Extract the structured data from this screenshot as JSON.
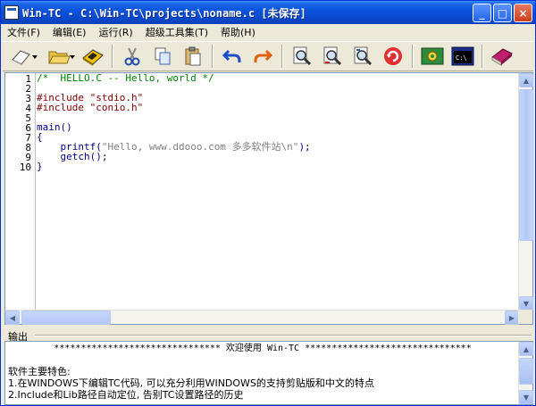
{
  "window": {
    "title": "Win-TC - C:\\Win-TC\\projects\\noname.c [未保存]",
    "controls": {
      "minimize": "_",
      "maximize": "□",
      "close": "×"
    }
  },
  "menu": {
    "items": [
      "文件(F)",
      "编辑(E)",
      "运行(R)",
      "超级工具集(T)",
      "帮助(H)"
    ]
  },
  "toolbar": {
    "icons": [
      "new-file-icon",
      "open-folder-icon",
      "save-disk-icon",
      "cut-icon",
      "copy-icon",
      "paste-icon",
      "undo-icon",
      "redo-icon",
      "find-icon",
      "find-next-icon",
      "replace-icon",
      "refresh-icon",
      "compile-icon",
      "run-console-icon",
      "help-book-icon"
    ]
  },
  "editor": {
    "line_numbers": [
      "1",
      "2",
      "3",
      "4",
      "5",
      "6",
      "7",
      "8",
      "9",
      "10"
    ],
    "lines": [
      {
        "text": "/*  HELLO.C -- Hello, world */",
        "kind": "comment"
      },
      {
        "text": "",
        "kind": "plain"
      },
      {
        "text": "#include \"stdio.h\"",
        "kind": "pre"
      },
      {
        "text": "#include \"conio.h\"",
        "kind": "pre"
      },
      {
        "text": "",
        "kind": "plain"
      },
      {
        "text": "main()",
        "kind": "plain"
      },
      {
        "text": "{",
        "kind": "plain"
      },
      {
        "text": "    printf(\"Hello, www.ddooo.com 多多软件站\\n\");",
        "kind": "mixed"
      },
      {
        "text": "    getch();",
        "kind": "plain"
      },
      {
        "text": "}",
        "kind": "plain"
      }
    ],
    "line8_parts": {
      "pre": "    printf(",
      "str": "\"Hello, www.ddooo.com 多多软件站\\n\"",
      "post": ");"
    }
  },
  "output": {
    "label": "输出",
    "lines": [
      "******************************* 欢迎使用 Win-TC *******************************",
      "",
      "软件主要特色:",
      "1.在WINDOWS下编辑TC代码, 可以充分利用WINDOWS的支持剪贴版和中文的特点",
      "2.Include和Lib路径自动定位, 告别TC设置路径的历史"
    ]
  },
  "colors": {
    "titlebar": "#0A54DC",
    "comment": "#008000",
    "preprocessor": "#800000",
    "string": "#808080",
    "code": "#000080"
  }
}
